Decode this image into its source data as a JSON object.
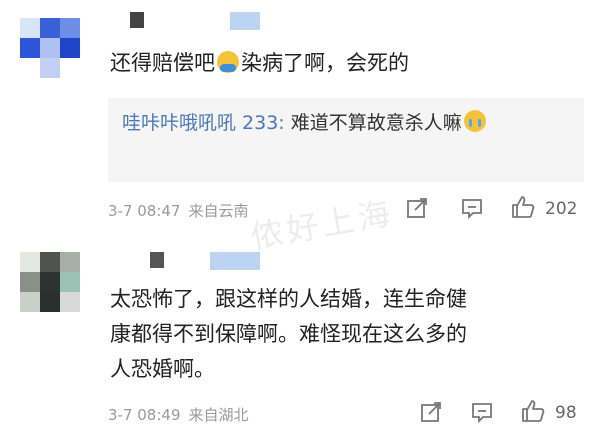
{
  "comments": [
    {
      "text": "还得赔偿吧",
      "text_after_emoji": "染病了啊，会死的",
      "emoji_icon": "pray-hands-emoji-icon",
      "reply": {
        "user": "哇咔咔哦吼吼 233:",
        "text": " 难道不算故意杀人嘛",
        "emoji_icon": "crying-emoji-icon"
      },
      "date": "3-7 08:47",
      "location": "来自云南",
      "likes": "202"
    },
    {
      "text": "太恐怖了，跟这样的人结婚，连生命健康都得不到保障啊。难怪现在这么多的人恐婚啊。",
      "date": "3-7 08:49",
      "location": "来自湖北",
      "likes": "98"
    }
  ],
  "watermark": "侬好上海",
  "colors": {
    "link": "#4a78b8",
    "meta": "#9a9a9a",
    "reply_bg": "#f5f5f5"
  }
}
